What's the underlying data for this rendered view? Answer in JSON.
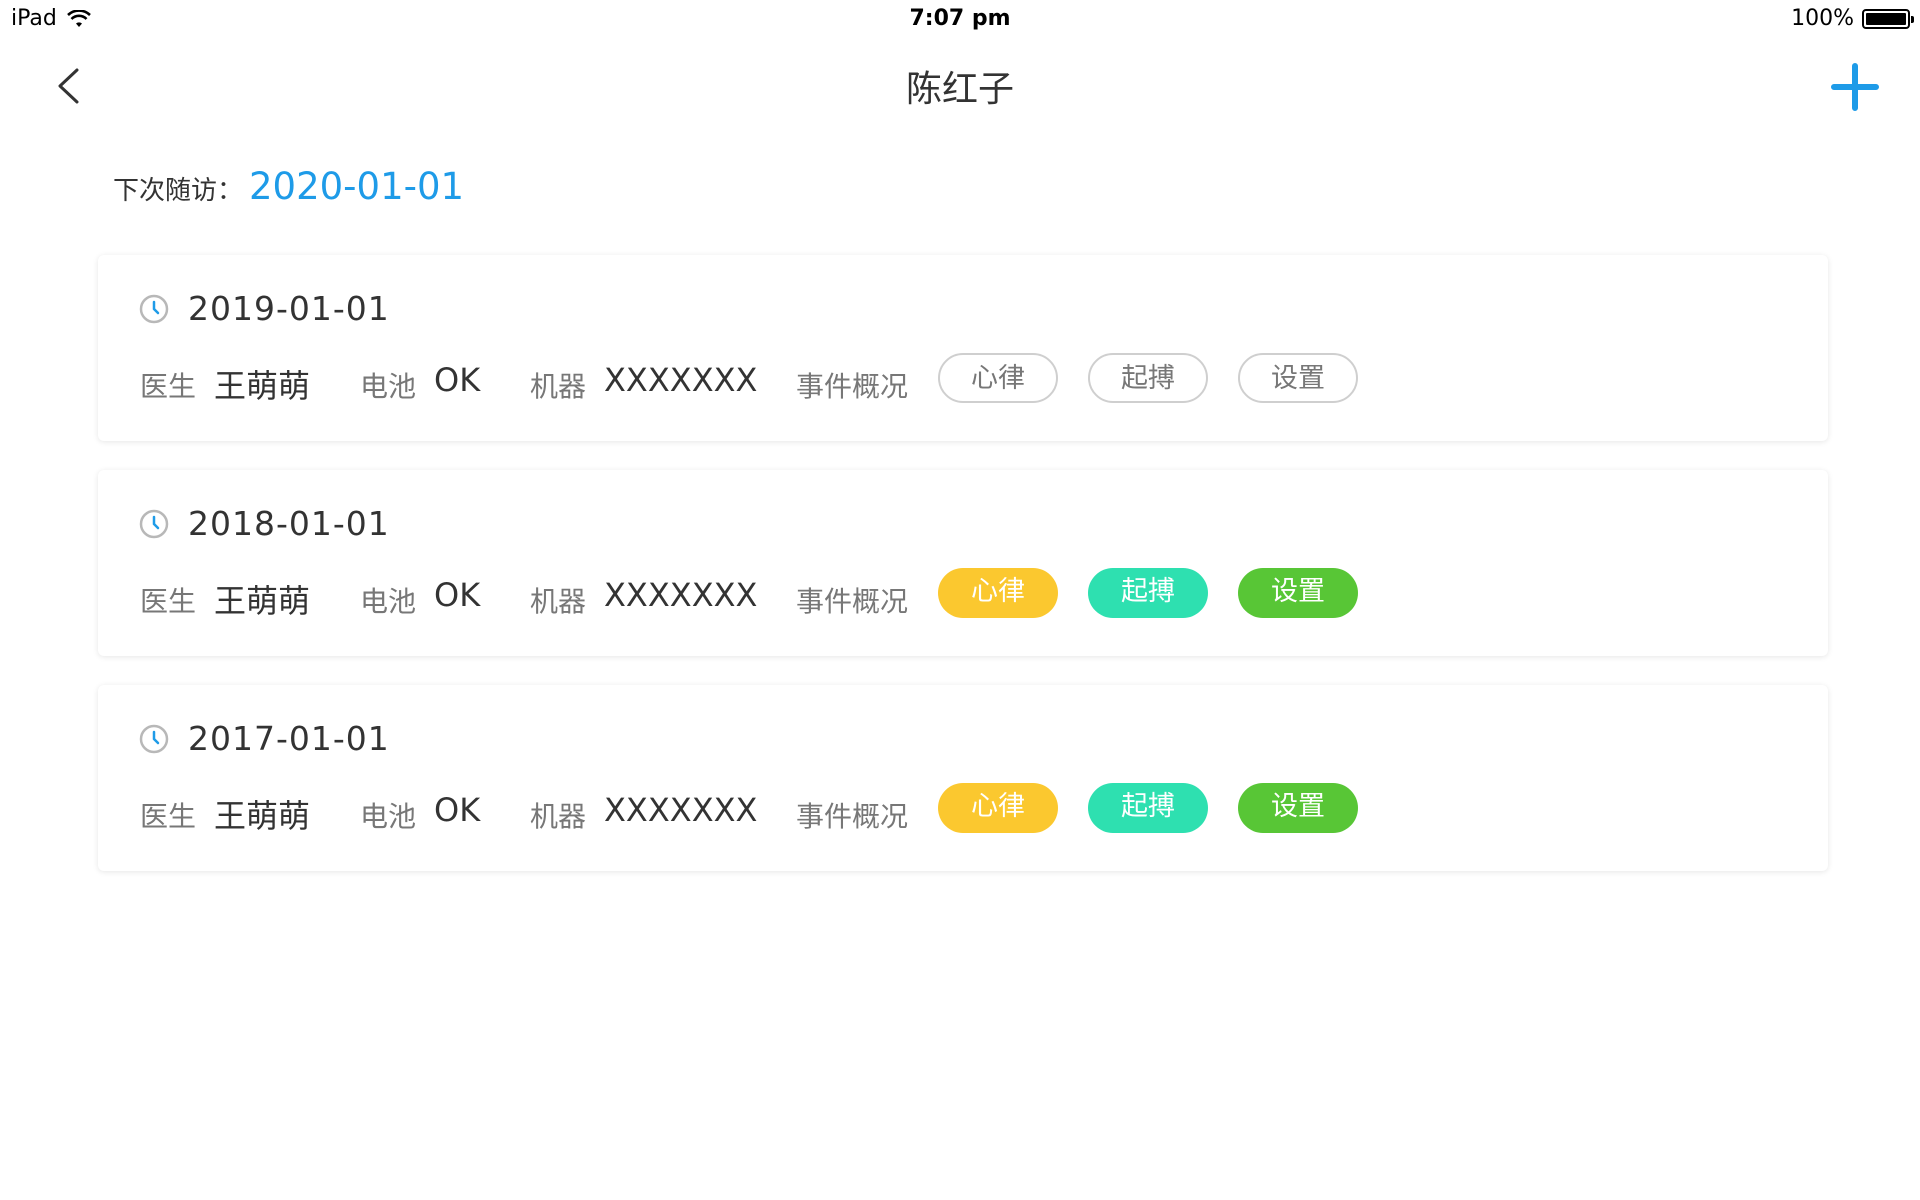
{
  "status_bar": {
    "device": "iPad",
    "time": "7:07 pm",
    "battery": "100%"
  },
  "nav": {
    "title": "陈红子"
  },
  "next_visit": {
    "label": "下次随访：",
    "value": "2020-01-01"
  },
  "labels": {
    "doctor": "医生",
    "battery": "电池",
    "machine": "机器",
    "events": "事件概况"
  },
  "records": [
    {
      "date": "2019-01-01",
      "doctor": "王萌萌",
      "battery": "OK",
      "machine": "XXXXXXX",
      "tags": [
        "心律",
        "起搏",
        "设置"
      ],
      "tag_style": "outline"
    },
    {
      "date": "2018-01-01",
      "doctor": "王萌萌",
      "battery": "OK",
      "machine": "XXXXXXX",
      "tags": [
        "心律",
        "起搏",
        "设置"
      ],
      "tag_style": "colored"
    },
    {
      "date": "2017-01-01",
      "doctor": "王萌萌",
      "battery": "OK",
      "machine": "XXXXXXX",
      "tags": [
        "心律",
        "起搏",
        "设置"
      ],
      "tag_style": "colored"
    }
  ],
  "colors": {
    "accent": "#1E9BE8",
    "tag_heart_rhythm": "#FBC82F",
    "tag_pacing": "#2EE0B0",
    "tag_settings": "#58C636"
  },
  "icons": {
    "back": "chevron-left-icon",
    "add": "plus-icon",
    "date": "clock-icon",
    "wifi": "wifi-icon",
    "battery": "battery-icon"
  }
}
